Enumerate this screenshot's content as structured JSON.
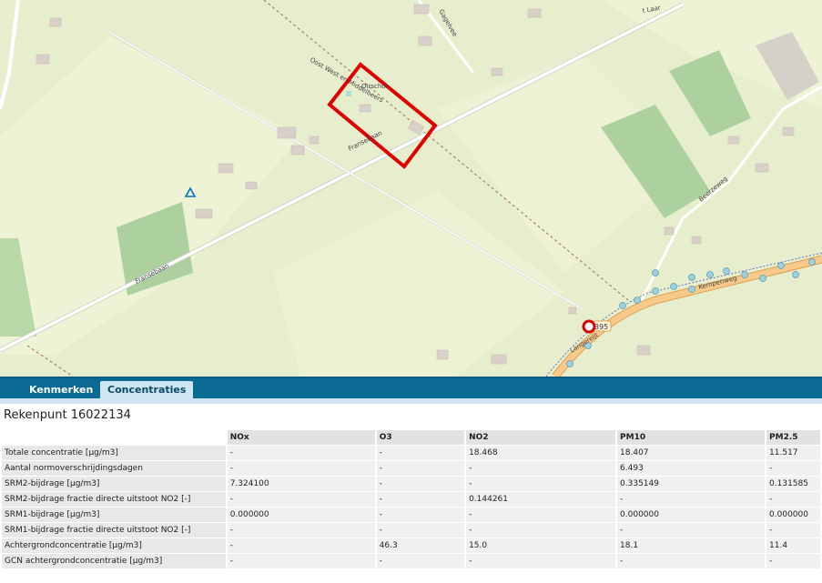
{
  "map": {
    "road_labels": [
      "Fransebaan",
      "Fransebaan",
      "Langereijt",
      "Kempenweg",
      "Oost West en Middelbeers",
      "Oirschot",
      "Gagelvee",
      "t Laar",
      "Beerzeweg"
    ],
    "route_number": "395",
    "colors": {
      "background": "#e6eecd",
      "field": "#f2f1dd",
      "forest": "#add19e",
      "road": "#ffffff",
      "main_road": "#f7c98a",
      "highlight_box": "#e00000",
      "marker": "#d40000"
    }
  },
  "tabs": [
    {
      "label": "Kenmerken",
      "active": false
    },
    {
      "label": "Concentraties",
      "active": true
    }
  ],
  "rekenpunt": "Rekenpunt 16022134",
  "table": {
    "columns": [
      "NOx",
      "O3",
      "NO2",
      "PM10",
      "PM2.5"
    ],
    "rows": [
      {
        "label": "Totale concentratie [µg/m3]",
        "values": [
          "-",
          "-",
          "18.468",
          "18.407",
          "11.517"
        ]
      },
      {
        "label": "Aantal normoverschrijdingsdagen",
        "values": [
          "-",
          "-",
          "-",
          "6.493",
          "-"
        ]
      },
      {
        "label": "SRM2-bijdrage [µg/m3]",
        "values": [
          "7.324100",
          "-",
          "-",
          "0.335149",
          "0.131585"
        ]
      },
      {
        "label": "SRM2-bijdrage fractie directe uitstoot NO2 [-]",
        "values": [
          "-",
          "-",
          "0.144261",
          "-",
          "-"
        ]
      },
      {
        "label": "SRM1-bijdrage [µg/m3]",
        "values": [
          "0.000000",
          "-",
          "-",
          "0.000000",
          "0.000000"
        ]
      },
      {
        "label": "SRM1-bijdrage fractie directe uitstoot NO2 [-]",
        "values": [
          "-",
          "-",
          "-",
          "-",
          "-"
        ]
      },
      {
        "label": "Achtergrondconcentratie [µg/m3]",
        "values": [
          "-",
          "46.3",
          "15.0",
          "18.1",
          "11.4"
        ]
      },
      {
        "label": "GCN achtergrondconcentratie [µg/m3]",
        "values": [
          "-",
          "-",
          "-",
          "-",
          "-"
        ]
      }
    ]
  }
}
